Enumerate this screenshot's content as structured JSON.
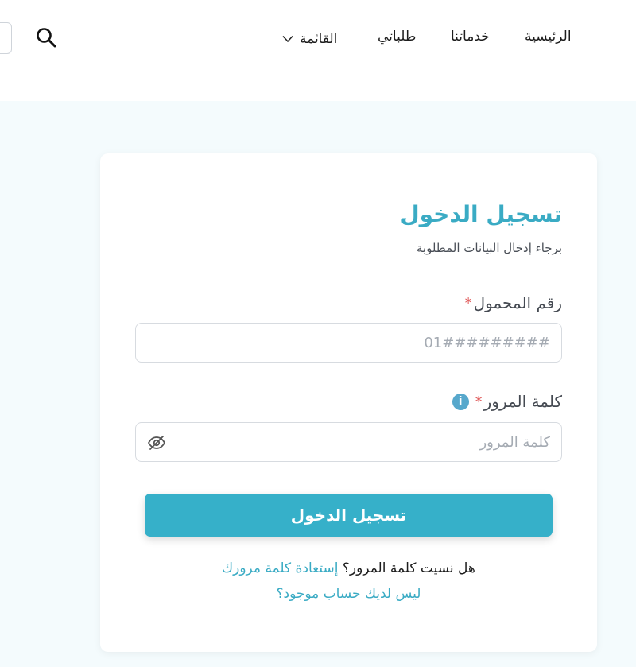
{
  "nav": {
    "home": "الرئيسية",
    "services": "خدماتنا",
    "orders": "طلباتي",
    "menu": "القائمة"
  },
  "login": {
    "title": "تسجيل الدخول",
    "subtitle": "برجاء إدخال البيانات المطلوبة",
    "phone_label": "رقم المحمول",
    "phone_placeholder": "01#########",
    "password_label": "كلمة المرور",
    "password_placeholder": "كلمة المرور",
    "required_mark": "*",
    "submit_label": "تسجيل الدخول",
    "forgot_question": "هل نسيت كلمة المرور؟",
    "forgot_link": "إستعادة كلمة مرورك",
    "no_account_link": "ليس لديك حساب موجود؟",
    "info_symbol": "i"
  },
  "colors": {
    "accent": "#36b0c9",
    "title": "#3aabc4",
    "required": "#e05a5a",
    "page_bg": "#f4fbfd"
  },
  "icons": {
    "search": "search-icon",
    "chevron": "chevron-down-icon",
    "info": "info-icon",
    "eye": "eye-off-icon"
  }
}
